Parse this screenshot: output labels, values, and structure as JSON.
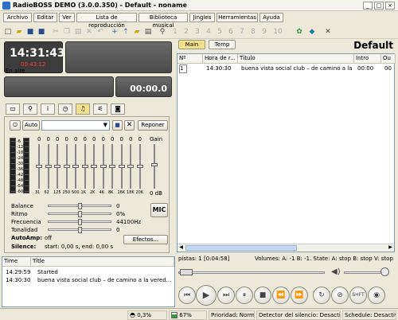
{
  "window": {
    "title": "RadioBOSS DEMO (3.0.0.350) - Default - noname",
    "min": "_",
    "max": "□",
    "close": "×"
  },
  "menu": [
    "Archivo",
    "Editar",
    "Ver",
    "Lista de reproducción",
    "Biblioteca musical",
    "Jingles",
    "Herramientas",
    "Ayuda"
  ],
  "toolbar": {
    "numbers": [
      "1",
      "2",
      "3",
      "4",
      "5",
      "6",
      "7",
      "8",
      "9",
      "10"
    ]
  },
  "clock": {
    "time": "14:31:43",
    "remaining": "00:43:12"
  },
  "on_air": {
    "label": "En aire",
    "time": "00:00.0"
  },
  "controls": {
    "auto_label": "Auto",
    "reponer_label": "Reponer"
  },
  "equalizer": {
    "gain_label": "Gain",
    "gain_value": "0 dB",
    "bands": [
      "31",
      "62",
      "125",
      "250",
      "500",
      "1K",
      "2K",
      "4K",
      "8K",
      "16K",
      "18K",
      "20K"
    ],
    "band_values": [
      "0",
      "0",
      "0",
      "0",
      "0",
      "0",
      "0",
      "0",
      "0",
      "0",
      "0",
      "0"
    ],
    "vu_scale": [
      "-6",
      "-12",
      "-18",
      "-24",
      "-30",
      "-36",
      "-42",
      "-48",
      "-54",
      "-60"
    ]
  },
  "mixer": {
    "rows": [
      {
        "label": "Balance",
        "value": "0"
      },
      {
        "label": "Ritmo",
        "value": "0%"
      },
      {
        "label": "Frecuencia",
        "value": "44100Hz"
      },
      {
        "label": "Tonalidad",
        "value": "0"
      }
    ],
    "autoamp_label": "AutoAmp:",
    "autoamp_value": "off",
    "silence_label": "Silence:",
    "silence_value": "start: 0,00 s,  end: 0,00 s",
    "mic_label": "MIC",
    "effects_label": "Efectos..."
  },
  "playlist": {
    "tabs": [
      "Main",
      "Temp"
    ],
    "name": "Default",
    "columns": [
      "Nº",
      "Hora de r...",
      "Título",
      "Intro",
      "Ou"
    ],
    "rows": [
      {
        "n": "1",
        "hora": "14:30:30",
        "titulo": "buena vista social club – de camino a la ver...",
        "intro": "00:00",
        "out": "00"
      }
    ],
    "summary": "pistas: 1 [0:04:58]",
    "volumes": "Volumes: A: -1 B: -1. State: A: stop B: stop V: stop"
  },
  "log": {
    "columns": [
      "Time",
      "Title"
    ],
    "rows": [
      {
        "time": "14:29:59",
        "title": "Started"
      },
      {
        "time": "14:30:30",
        "title": "buena vista social club – de camino a la vered..."
      }
    ]
  },
  "status": {
    "cpu": "0,3%",
    "mem": "67%",
    "priority": "Prioridad: Normal",
    "silence": "Detector del silencio: Desactivado",
    "schedule": "Schedule: Desactivado"
  },
  "colors": {
    "display_bg": "#3c3c3c",
    "remaining_red": "#ff3a3a",
    "selected_tab": "#f7e08a"
  },
  "progress": {
    "mem_fraction": 0.67
  }
}
